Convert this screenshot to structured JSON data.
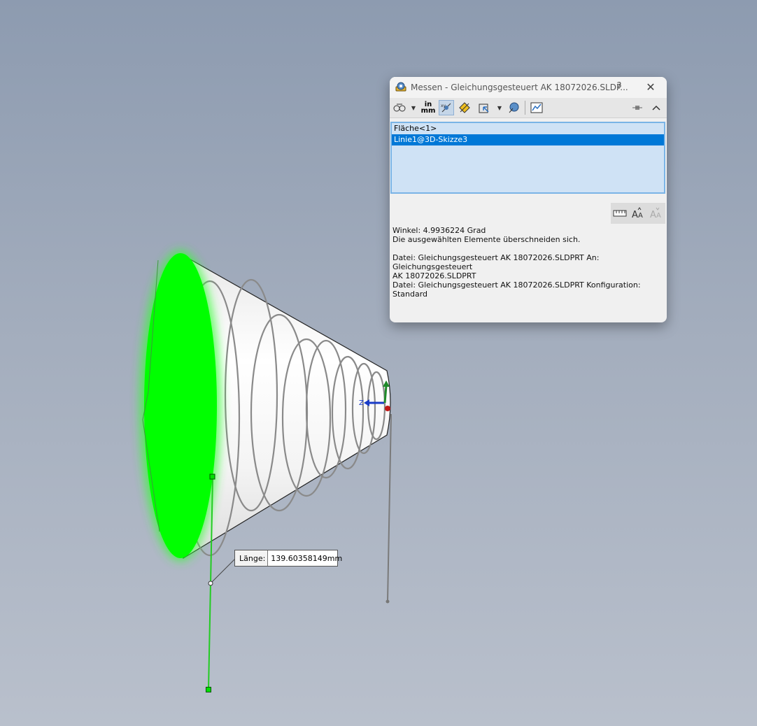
{
  "dialog": {
    "title": "Messen - Gleichungsgesteuert AK 18072026.SLDP...",
    "help_label": "?",
    "close_label": "✕",
    "toolbar": {
      "inch_mm_top": "in",
      "inch_mm_bottom": "mm",
      "icons": [
        "arc-circle-measure-icon",
        "units-precision-icon",
        "show-xyz-icon",
        "point-to-point-icon",
        "projection-icon",
        "coordinate-system-icon",
        "history-icon",
        "pin-icon",
        "collapse-icon"
      ]
    },
    "selections": [
      {
        "label": "Fläche<1>",
        "selected": false
      },
      {
        "label": "Linie1@3D-Skizze3",
        "selected": true
      }
    ],
    "results": [
      "Winkel: 4.9936224 Grad",
      "Die ausgewählten Elemente überschneiden sich.",
      "",
      "Datei: Gleichungsgesteuert AK 18072026.SLDPRT An: Gleichungsgesteuert",
      "AK 18072026.SLDPRT",
      "Datei: Gleichungsgesteuert AK 18072026.SLDPRT Konfiguration: Standard"
    ]
  },
  "viewport": {
    "triad_z_label": "Z",
    "dimension": {
      "label": "Länge:",
      "value": "139.60358149mm"
    },
    "colors": {
      "face_highlight": "#00ff00",
      "sketch_line": "#22cc22",
      "background_top": "#8d9bb0",
      "background_bottom": "#b9c0cc"
    }
  }
}
